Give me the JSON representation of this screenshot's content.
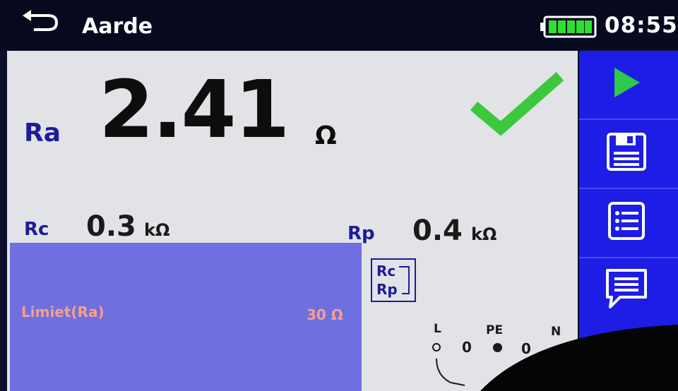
{
  "header": {
    "title": "Aarde",
    "time": "08:55",
    "battery_level": 1.0
  },
  "main": {
    "ra": {
      "label": "Ra",
      "value": "2.41",
      "unit": "Ω",
      "status_icon": "check-icon",
      "status_color": "#3cc83c"
    },
    "rc": {
      "label": "Rc",
      "value": "0.3",
      "unit": "kΩ"
    },
    "rp": {
      "label": "Rp",
      "value": "0.4",
      "unit": "kΩ"
    },
    "limit": {
      "label": "Limiet(Ra)",
      "value": "30 Ω"
    },
    "rcrp_toggle": {
      "line1": "Rc",
      "line2": "Rp"
    },
    "terminals": {
      "l": "L",
      "pe": "PE",
      "n": "N",
      "l_pe": "0",
      "pe_n": "0"
    }
  },
  "sidebar": {
    "buttons": [
      {
        "icon": "play-icon"
      },
      {
        "icon": "save-icon"
      },
      {
        "icon": "list-icon"
      },
      {
        "icon": "comment-icon"
      }
    ]
  },
  "colors": {
    "accent_blue": "#1d1de6",
    "label_blue": "#1c1c9a",
    "limit_text": "#f4a08a",
    "pass_green": "#3cc83c",
    "play_green": "#2ec84a"
  }
}
